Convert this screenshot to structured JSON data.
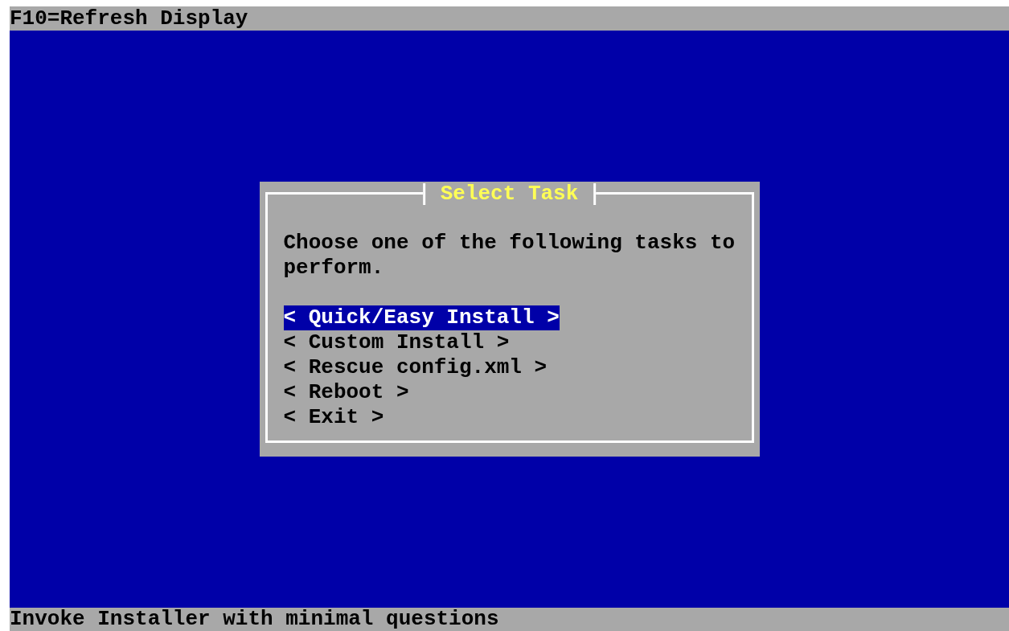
{
  "top_bar": {
    "text": "F10=Refresh Display"
  },
  "dialog": {
    "title": "Select Task",
    "message": "Choose one of the following tasks to perform.",
    "items": [
      {
        "label": "< Quick/Easy Install >",
        "selected": true
      },
      {
        "label": "< Custom Install >",
        "selected": false
      },
      {
        "label": "< Rescue config.xml >",
        "selected": false
      },
      {
        "label": "< Reboot >",
        "selected": false
      },
      {
        "label": "< Exit >",
        "selected": false
      }
    ]
  },
  "status_bar": {
    "text": "Invoke Installer with minimal questions"
  }
}
